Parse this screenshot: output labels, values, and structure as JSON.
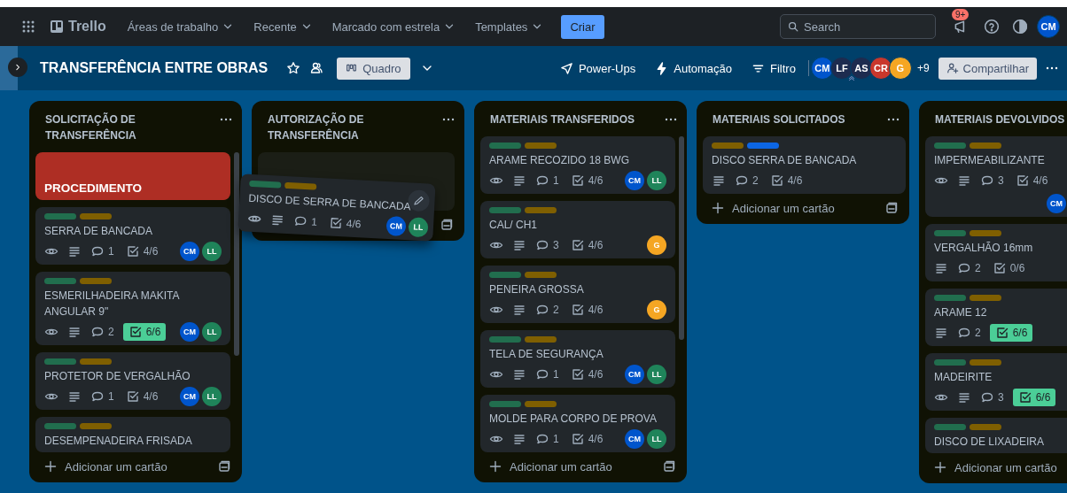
{
  "nav": {
    "menus": [
      {
        "label": "Áreas de trabalho"
      },
      {
        "label": "Recente"
      },
      {
        "label": "Marcado com estrela"
      },
      {
        "label": "Templates"
      }
    ],
    "logo": "Trello",
    "create": "Criar",
    "search": {
      "placeholder": "Search"
    },
    "notifications": "9+",
    "avatar": {
      "initials": "CM",
      "color": "#0055cc"
    }
  },
  "board": {
    "title": "TRANSFERÊNCIA ENTRE OBRAS",
    "view": "Quadro",
    "actions": [
      {
        "kind": "power-ups",
        "label": "Power-Ups"
      },
      {
        "kind": "automation",
        "label": "Automação"
      },
      {
        "kind": "filter",
        "label": "Filtro"
      }
    ],
    "members": [
      {
        "initials": "CM",
        "color": "#0055cc",
        "admin": false
      },
      {
        "initials": "LF",
        "color": "#1d2b4f",
        "admin": true
      },
      {
        "initials": "AS",
        "color": "#1d2b4f",
        "admin": false
      },
      {
        "initials": "CR",
        "color": "#c9372c",
        "admin": false
      },
      {
        "initials": "G",
        "color": "#f5a623",
        "admin": false
      }
    ],
    "more_members": "+9",
    "share": "Compartilhar"
  },
  "lists": [
    {
      "title": "SOLICITAÇÃO DE TRANSFERÊNCIA",
      "scrollbar": true,
      "add_label": "Adicionar um cartão",
      "cards": [
        {
          "kind": "cover",
          "title": "PROCEDIMENTO",
          "color": "#ae2e24"
        },
        {
          "kind": "card",
          "labels": [
            {
              "color": "#216e4e"
            },
            {
              "color": "#7f5f01"
            }
          ],
          "title": "SERRA DE BANCADA",
          "watching": true,
          "description": true,
          "comments": "1",
          "checklist": {
            "text": "4/6",
            "complete": false
          },
          "members": [
            {
              "initials": "CM",
              "color": "#0055cc"
            },
            {
              "initials": "LL",
              "color": "#1f845a"
            }
          ]
        },
        {
          "kind": "card",
          "labels": [
            {
              "color": "#216e4e"
            },
            {
              "color": "#7f5f01"
            }
          ],
          "title": "ESMERILHADEIRA MAKITA ANGULAR 9\"",
          "watching": true,
          "description": true,
          "comments": "2",
          "checklist": {
            "text": "6/6",
            "complete": true
          },
          "members": [
            {
              "initials": "CM",
              "color": "#0055cc"
            },
            {
              "initials": "LL",
              "color": "#1f845a"
            }
          ]
        },
        {
          "kind": "card",
          "labels": [
            {
              "color": "#216e4e"
            },
            {
              "color": "#7f5f01"
            }
          ],
          "title": "PROTETOR DE VERGALHÃO",
          "watching": true,
          "description": true,
          "comments": "1",
          "checklist": {
            "text": "4/6",
            "complete": false
          },
          "members": [
            {
              "initials": "CM",
              "color": "#0055cc"
            },
            {
              "initials": "LL",
              "color": "#1f845a"
            }
          ]
        },
        {
          "kind": "card",
          "labels": [
            {
              "color": "#216e4e"
            },
            {
              "color": "#7f5f01"
            }
          ],
          "title": "DESEMPENADEIRA FRISADA",
          "watching": false,
          "description": false
        }
      ]
    },
    {
      "title": "AUTORIZAÇÃO DE TRANSFERÊNCIA",
      "scrollbar": false,
      "cards": [
        {
          "kind": "placeholder"
        }
      ]
    },
    {
      "title": "MATERIAIS TRANSFERIDOS",
      "scrollbar": true,
      "add_label": "Adicionar um cartão",
      "cards": [
        {
          "kind": "card",
          "labels": [
            {
              "color": "#216e4e"
            },
            {
              "color": "#7f5f01"
            }
          ],
          "title": "ARAME RECOZIDO 18 BWG",
          "watching": true,
          "description": true,
          "comments": "1",
          "checklist": {
            "text": "4/6",
            "complete": false
          },
          "members": [
            {
              "initials": "CM",
              "color": "#0055cc"
            },
            {
              "initials": "LL",
              "color": "#1f845a"
            }
          ]
        },
        {
          "kind": "card",
          "labels": [
            {
              "color": "#216e4e"
            },
            {
              "color": "#7f5f01"
            }
          ],
          "title": "CAL/ CH1",
          "watching": true,
          "description": true,
          "comments": "3",
          "checklist": {
            "text": "4/6",
            "complete": false
          },
          "members": [
            {
              "initials": "G",
              "color": "#f5a623"
            }
          ]
        },
        {
          "kind": "card",
          "labels": [
            {
              "color": "#216e4e"
            },
            {
              "color": "#7f5f01"
            }
          ],
          "title": "PENEIRA GROSSA",
          "watching": true,
          "description": true,
          "comments": "2",
          "checklist": {
            "text": "4/6",
            "complete": false
          },
          "members": [
            {
              "initials": "G",
              "color": "#f5a623"
            }
          ]
        },
        {
          "kind": "card",
          "labels": [
            {
              "color": "#216e4e"
            },
            {
              "color": "#7f5f01"
            }
          ],
          "title": "TELA DE SEGURANÇA",
          "watching": true,
          "description": true,
          "comments": "1",
          "checklist": {
            "text": "4/6",
            "complete": false
          },
          "members": [
            {
              "initials": "CM",
              "color": "#0055cc"
            },
            {
              "initials": "LL",
              "color": "#1f845a"
            }
          ]
        },
        {
          "kind": "card",
          "labels": [
            {
              "color": "#216e4e"
            },
            {
              "color": "#7f5f01"
            }
          ],
          "title": "MOLDE PARA CORPO DE PROVA",
          "watching": true,
          "description": true,
          "comments": "1",
          "checklist": {
            "text": "4/6",
            "complete": false
          },
          "members": [
            {
              "initials": "CM",
              "color": "#0055cc"
            },
            {
              "initials": "LL",
              "color": "#1f845a"
            }
          ]
        }
      ]
    },
    {
      "title": "MATERIAIS SOLICITADOS",
      "scrollbar": false,
      "add_label": "Adicionar um cartão",
      "cards": [
        {
          "kind": "card",
          "labels": [
            {
              "color": "#7f5f01"
            },
            {
              "color": "#0c66e4"
            }
          ],
          "title": "DISCO SERRA DE BANCADA",
          "watching": false,
          "description": true,
          "comments": "2",
          "checklist": {
            "text": "4/6",
            "complete": false
          }
        }
      ]
    },
    {
      "title": "MATERIAIS DEVOLVIDOS",
      "scrollbar": false,
      "add_label": "Adicionar um cartão",
      "cards": [
        {
          "kind": "card",
          "labels": [
            {
              "color": "#216e4e"
            },
            {
              "color": "#7f5f01"
            }
          ],
          "title": "IMPERMEABILIZANTE",
          "watching": true,
          "description": true,
          "comments": "3",
          "checklist": {
            "text": "4/6",
            "complete": false
          },
          "members_below": true,
          "members": [
            {
              "initials": "CM",
              "color": "#0055cc"
            }
          ]
        },
        {
          "kind": "card",
          "labels": [
            {
              "color": "#216e4e"
            },
            {
              "color": "#7f5f01"
            }
          ],
          "title": "VERGALHÃO 16mm",
          "watching": false,
          "description": true,
          "comments": "2",
          "checklist": {
            "text": "0/6",
            "complete": false
          }
        },
        {
          "kind": "card",
          "labels": [
            {
              "color": "#216e4e"
            },
            {
              "color": "#7f5f01"
            }
          ],
          "title": "ARAME 12",
          "watching": false,
          "description": true,
          "comments": "2",
          "checklist": {
            "text": "6/6",
            "complete": true
          }
        },
        {
          "kind": "card",
          "labels": [
            {
              "color": "#216e4e"
            },
            {
              "color": "#7f5f01"
            }
          ],
          "title": "MADEIRITE",
          "watching": true,
          "description": true,
          "comments": "3",
          "checklist": {
            "text": "6/6",
            "complete": true
          }
        },
        {
          "kind": "card",
          "labels": [
            {
              "color": "#216e4e"
            },
            {
              "color": "#7f5f01"
            }
          ],
          "title": "DISCO DE LIXADEIRA",
          "watching": false,
          "description": false
        }
      ]
    }
  ],
  "dragged_card": {
    "kind": "card",
    "labels": [
      {
        "color": "#216e4e"
      },
      {
        "color": "#7f5f01"
      }
    ],
    "title": "DISCO DE SERRA DE BANCADA",
    "watching": true,
    "description": true,
    "comments": "1",
    "checklist": {
      "text": "4/6",
      "complete": false
    },
    "members": [
      {
        "initials": "CM",
        "color": "#0055cc"
      },
      {
        "initials": "LL",
        "color": "#1f845a"
      }
    ]
  }
}
